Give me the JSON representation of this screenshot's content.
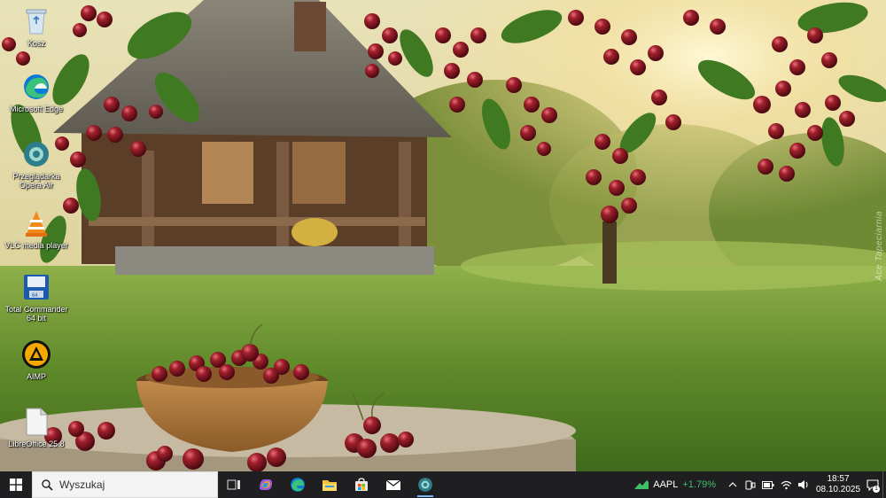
{
  "desktop": {
    "icons": [
      {
        "label": "Kosz",
        "icon": "recycle-bin-icon"
      },
      {
        "label": "Microsoft Edge",
        "icon": "edge-icon"
      },
      {
        "label": "Przeglądarka Opera Air",
        "icon": "opera-air-icon"
      },
      {
        "label": "VLC media player",
        "icon": "vlc-icon"
      },
      {
        "label": "Total Commander 64 bit",
        "icon": "total-commander-icon"
      },
      {
        "label": "AIMP",
        "icon": "aimp-icon"
      },
      {
        "label": "LibreOffice 25.8",
        "icon": "libreoffice-icon"
      }
    ],
    "watermark": "Ace Tapeciarnia"
  },
  "taskbar": {
    "search_placeholder": "Wyszukaj",
    "apps": [
      "task-view-icon",
      "copilot-icon",
      "edge-icon",
      "file-explorer-icon",
      "microsoft-store-icon",
      "mail-icon",
      "opera-air-icon"
    ],
    "stock": {
      "symbol": "AAPL",
      "change": "+1.79%"
    },
    "clock": {
      "time": "18:57",
      "date": "08.10.2025"
    },
    "notifications": "1"
  },
  "colors": {
    "taskbar": "#1f1f22",
    "accent": "#76b9ed",
    "stock_up": "#3fbf6a"
  }
}
